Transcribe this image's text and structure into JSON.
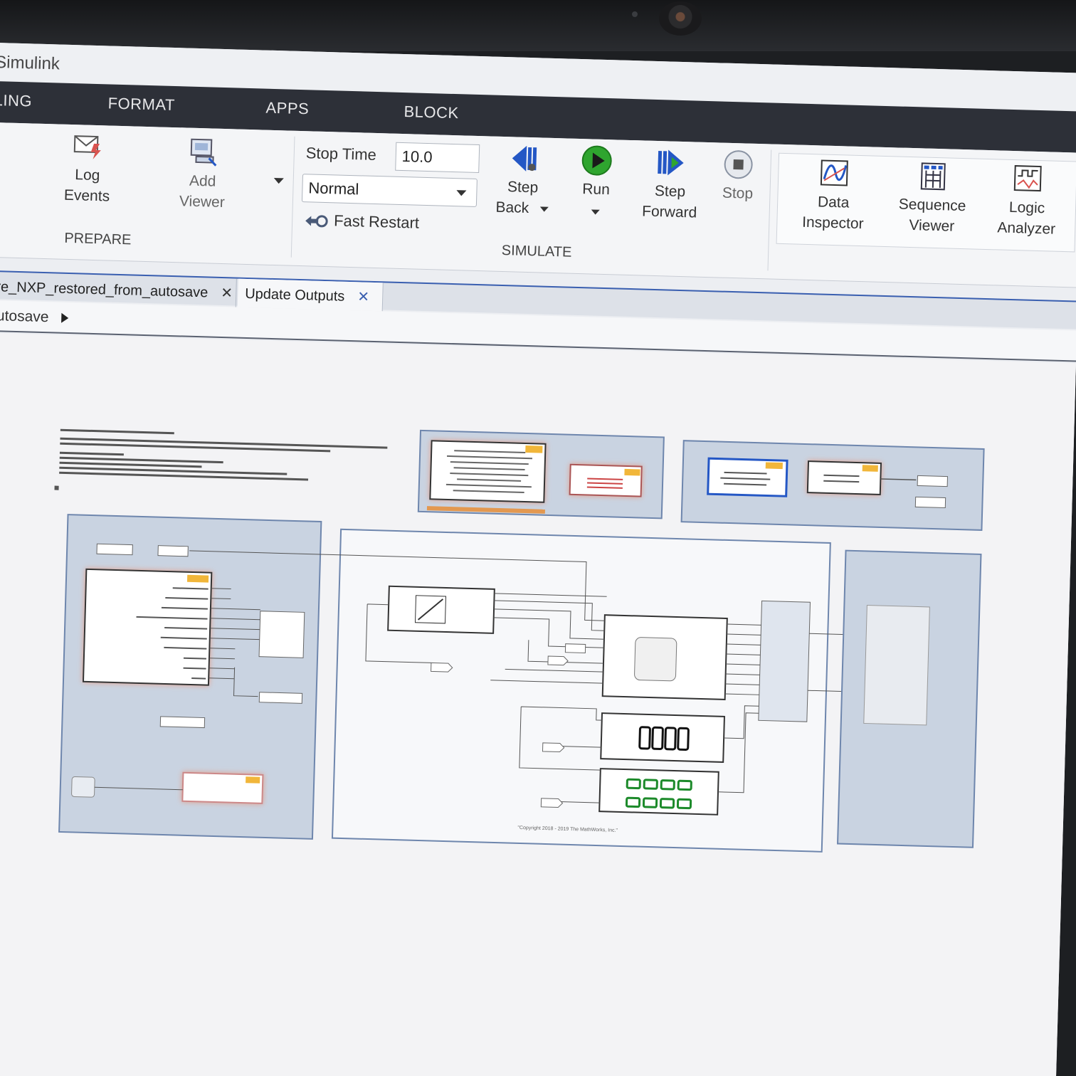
{
  "window": {
    "title": "Simulink"
  },
  "top_tabs": [
    "LING",
    "FORMAT",
    "APPS",
    "BLOCK"
  ],
  "ribbon": {
    "prepare": {
      "label": "PREPARE",
      "log_events": [
        "Log",
        "Events"
      ],
      "add_viewer": [
        "Add",
        "Viewer"
      ]
    },
    "simulate": {
      "label": "SIMULATE",
      "stop_time_label": "Stop Time",
      "stop_time_value": "10.0",
      "mode": "Normal",
      "fast_restart": "Fast Restart",
      "step_back": [
        "Step",
        "Back"
      ],
      "run": "Run",
      "step_forward": [
        "Step",
        "Forward"
      ],
      "stop": "Stop"
    },
    "review": {
      "data_inspector": [
        "Data",
        "Inspector"
      ],
      "sequence_viewer": [
        "Sequence",
        "Viewer"
      ],
      "logic_analyzer": [
        "Logic",
        "Analyzer"
      ]
    }
  },
  "doc_tabs": [
    {
      "label": "re_NXP_restored_from_autosave",
      "close": "✕"
    },
    {
      "label": "Update Outputs",
      "close": "✕"
    }
  ],
  "breadcrumb": {
    "label": "autosave"
  },
  "canvas": {
    "copyright": "\"Copyright 2018 - 2019 The MathWorks, Inc.\""
  },
  "colors": {
    "tabstrip": "#2d3038",
    "run_green": "#2fa52f",
    "step_blue": "#2457c5",
    "area_fill": "#c9d3e1",
    "nxp_highlight": "#e3a08c"
  }
}
